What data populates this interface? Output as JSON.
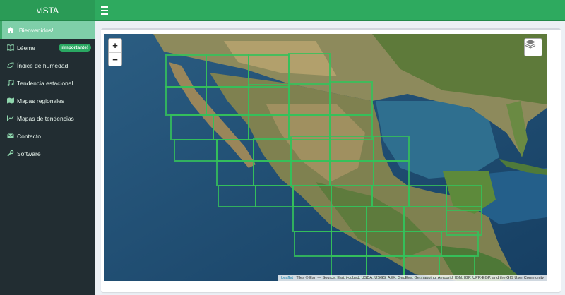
{
  "header": {
    "brand": "viSTA",
    "menu_icon": "bars-icon",
    "color": "#2eaa5f"
  },
  "sidebar": {
    "items": [
      {
        "label": "¡Bienvenidos!",
        "icon": "home-icon",
        "active": true
      },
      {
        "label": "Léeme",
        "icon": "book-icon",
        "badge": "¡Importante!"
      },
      {
        "label": "Índice de humedad",
        "icon": "leaf-icon"
      },
      {
        "label": "Tendencia estacional",
        "icon": "music-icon"
      },
      {
        "label": "Mapas regionales",
        "icon": "map-icon"
      },
      {
        "label": "Mapas de tendencias",
        "icon": "line-chart-icon"
      },
      {
        "label": "Contacto",
        "icon": "envelope-icon"
      },
      {
        "label": "Software",
        "icon": "wrench-icon"
      }
    ]
  },
  "map": {
    "zoom_in": "+",
    "zoom_out": "−",
    "layers_icon": "layers-icon",
    "grid_color": "#35c15a",
    "attribution_link": "Leaflet",
    "attribution_text": " | Tiles © Esri — Source: Esri, i-cubed, USDA, USGS, AEX, GeoEye, Getmapping, Aerogrid, IGN, IGP, UPR-EGP, and the GIS User Community"
  }
}
